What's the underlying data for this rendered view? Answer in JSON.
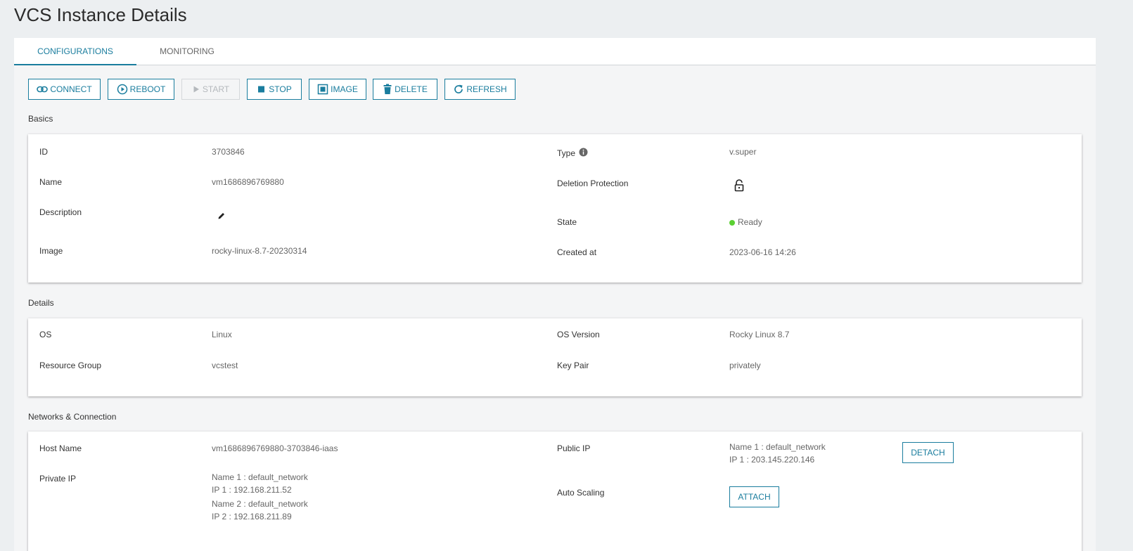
{
  "page": {
    "title": "VCS Instance Details"
  },
  "tabs": [
    {
      "label": "CONFIGURATIONS",
      "active": true
    },
    {
      "label": "MONITORING",
      "active": false
    }
  ],
  "toolbar": {
    "connect": "CONNECT",
    "reboot": "REBOOT",
    "start": "START",
    "stop": "STOP",
    "image": "IMAGE",
    "delete": "DELETE",
    "refresh": "REFRESH"
  },
  "basics": {
    "heading": "Basics",
    "id_label": "ID",
    "id": "3703846",
    "name_label": "Name",
    "name": "vm1686896769880",
    "description_label": "Description",
    "image_label": "Image",
    "image": "rocky-linux-8.7-20230314",
    "type_label": "Type",
    "type": "v.super",
    "deletion_protection_label": "Deletion Protection",
    "state_label": "State",
    "state": "Ready",
    "created_label": "Created at",
    "created": "2023-06-16 14:26"
  },
  "details": {
    "heading": "Details",
    "os_label": "OS",
    "os": "Linux",
    "rg_label": "Resource Group",
    "rg": "vcstest",
    "os_version_label": "OS Version",
    "os_version": "Rocky Linux 8.7",
    "key_pair_label": "Key Pair",
    "key_pair": "privately"
  },
  "network": {
    "heading": "Networks & Connection",
    "host_label": "Host Name",
    "host": "vm1686896769880-3703846-iaas",
    "private_ip_label": "Private IP",
    "private_ip_1": "Name 1 : default_network\nIP 1 : 192.168.211.52",
    "private_ip_2": "Name 2 : default_network\nIP 2 : 192.168.211.89",
    "public_ip_label": "Public IP",
    "public_ip": "Name 1 : default_network\nIP 1 : 203.145.220.146",
    "detach": "DETACH",
    "auto_scaling_label": "Auto Scaling",
    "attach": "ATTACH"
  },
  "colors": {
    "accent": "#1a7d9e",
    "ready": "#5bd033"
  }
}
